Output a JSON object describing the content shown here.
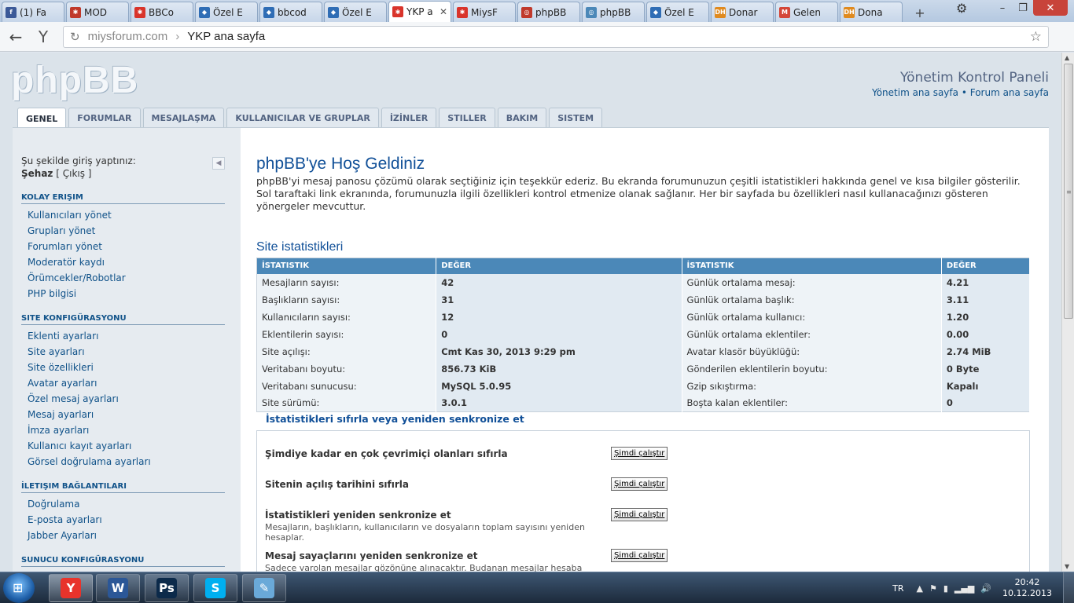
{
  "browser": {
    "tabs": [
      {
        "label": "(1) Fa",
        "color": "#3b5998",
        "glyph": "f",
        "active": false
      },
      {
        "label": "MOD",
        "color": "#c0392b",
        "glyph": "✱",
        "active": false
      },
      {
        "label": "BBCo",
        "color": "#d9342b",
        "glyph": "✱",
        "active": false
      },
      {
        "label": "Özel E",
        "color": "#2f6db5",
        "glyph": "◆",
        "active": false
      },
      {
        "label": "bbcod",
        "color": "#2f6db5",
        "glyph": "◆",
        "active": false
      },
      {
        "label": "Özel E",
        "color": "#2f6db5",
        "glyph": "◆",
        "active": false
      },
      {
        "label": "YKP a",
        "color": "#d9342b",
        "glyph": "✱",
        "active": true
      },
      {
        "label": "MiysF",
        "color": "#d9342b",
        "glyph": "✱",
        "active": false
      },
      {
        "label": "phpBB",
        "color": "#c0392b",
        "glyph": "◎",
        "active": false
      },
      {
        "label": "phpBB",
        "color": "#4b88b8",
        "glyph": "◎",
        "active": false
      },
      {
        "label": "Özel E",
        "color": "#2f6db5",
        "glyph": "◆",
        "active": false
      },
      {
        "label": "Donar",
        "color": "#e08a1e",
        "glyph": "DH",
        "active": false
      },
      {
        "label": "Gelen",
        "color": "#d44638",
        "glyph": "M",
        "active": false
      },
      {
        "label": "Dona",
        "color": "#e08a1e",
        "glyph": "DH",
        "active": false
      }
    ],
    "new_tab": "+",
    "url_domain": "miysforum.com",
    "url_separator": "›",
    "page_title": "YKP ana sayfa",
    "logo_glyph": "Y"
  },
  "header": {
    "logo_text": "phpBB",
    "acp_title": "Yönetim Kontrol Paneli",
    "link_home": "Yönetim ana sayfa",
    "link_sep": " • ",
    "link_forum": "Forum ana sayfa"
  },
  "nav_tabs": [
    {
      "label": "GENEL",
      "active": true
    },
    {
      "label": "FORUMLAR",
      "active": false
    },
    {
      "label": "MESAJLAŞMA",
      "active": false
    },
    {
      "label": "KULLANICILAR VE GRUPLAR",
      "active": false
    },
    {
      "label": "İZİNLER",
      "active": false
    },
    {
      "label": "STILLER",
      "active": false
    },
    {
      "label": "BAKIM",
      "active": false
    },
    {
      "label": "SISTEM",
      "active": false
    }
  ],
  "sidebar": {
    "login_label": "Şu şekilde giriş yaptınız:",
    "username": "Şehaz",
    "logout": "[ Çıkış ]",
    "groups": [
      {
        "title": "KOLAY ERIŞIM",
        "items": [
          "Kullanıcıları yönet",
          "Grupları yönet",
          "Forumları yönet",
          "Moderatör kaydı",
          "Örümcekler/Robotlar",
          "PHP bilgisi"
        ]
      },
      {
        "title": "SITE KONFIGÜRASYONU",
        "items": [
          "Eklenti ayarları",
          "Site ayarları",
          "Site özellikleri",
          "Avatar ayarları",
          "Özel mesaj ayarları",
          "Mesaj ayarları",
          "İmza ayarları",
          "Kullanıcı kayıt ayarları",
          "Görsel doğrulama ayarları"
        ]
      },
      {
        "title": "İLETIŞIM BAĞLANTILARI",
        "items": [
          "Doğrulama",
          "E-posta ayarları",
          "Jabber Ayarları"
        ]
      },
      {
        "title": "SUNUCU KONFIGÜRASYONU",
        "items": []
      }
    ]
  },
  "main": {
    "welcome_title": "phpBB'ye Hoş Geldiniz",
    "welcome_text": "phpBB'yi mesaj panosu çözümü olarak seçtiğiniz için teşekkür ederiz. Bu ekranda forumunuzun çeşitli istatistikleri hakkında genel ve kısa bilgiler gösterilir. Sol taraftaki link ekranında, forumunuzla ilgili özellikleri kontrol etmenize olanak sağlanır. Her bir sayfada bu özellikleri nasıl kullanacağınızı gösteren yönergeler mevcuttur.",
    "stats_title": "Site istatistikleri",
    "stats_headers": [
      "İSTATISTIK",
      "DEĞER",
      "İSTATISTIK",
      "DEĞER"
    ],
    "stats_rows": [
      [
        "Mesajların sayısı:",
        "42",
        "Günlük ortalama mesaj:",
        "4.21"
      ],
      [
        "Başlıkların sayısı:",
        "31",
        "Günlük ortalama başlık:",
        "3.11"
      ],
      [
        "Kullanıcıların sayısı:",
        "12",
        "Günlük ortalama kullanıcı:",
        "1.20"
      ],
      [
        "Eklentilerin sayısı:",
        "0",
        "Günlük ortalama eklentiler:",
        "0.00"
      ],
      [
        "Site açılışı:",
        "Cmt Kas 30, 2013 9:29 pm",
        "Avatar klasör büyüklüğü:",
        "2.74 MiB"
      ],
      [
        "Veritabanı boyutu:",
        "856.73 KiB",
        "Gönderilen eklentilerin boyutu:",
        "0 Byte"
      ],
      [
        "Veritabanı sunucusu:",
        "MySQL 5.0.95",
        "Gzip sıkıştırma:",
        "Kapalı"
      ],
      [
        "Site sürümü:",
        "3.0.1",
        "Boşta kalan eklentiler:",
        "0"
      ]
    ],
    "resync_title": "İstatistikleri sıfırla veya yeniden senkronize et",
    "resync_button": "Şimdi çalıştır",
    "resync_items": [
      {
        "label": "Şimdiye kadar en çok çevrimiçi olanları sıfırla",
        "desc": ""
      },
      {
        "label": "Sitenin açılış tarihini sıfırla",
        "desc": ""
      },
      {
        "label": "İstatistikleri yeniden senkronize et",
        "desc": "Mesajların, başlıkların, kullanıcıların ve dosyaların toplam sayısını yeniden hesaplar."
      },
      {
        "label": "Mesaj sayaçlarını yeniden senkronize et",
        "desc": "Sadece varolan mesajlar gözönüne alınacaktır. Budanan mesajlar hesaba"
      }
    ]
  },
  "taskbar": {
    "apps": [
      {
        "name": "yandex-browser",
        "glyph": "Y",
        "color": "#e8332b",
        "active": true
      },
      {
        "name": "word",
        "glyph": "W",
        "color": "#2b5797",
        "active": false
      },
      {
        "name": "photoshop",
        "glyph": "Ps",
        "color": "#0c2a4a",
        "active": false
      },
      {
        "name": "skype",
        "glyph": "S",
        "color": "#00aff0",
        "active": false
      },
      {
        "name": "notepad",
        "glyph": "✎",
        "color": "#6aa9d8",
        "active": false
      }
    ],
    "lang": "TR",
    "time": "20:42",
    "date": "10.12.2013"
  }
}
